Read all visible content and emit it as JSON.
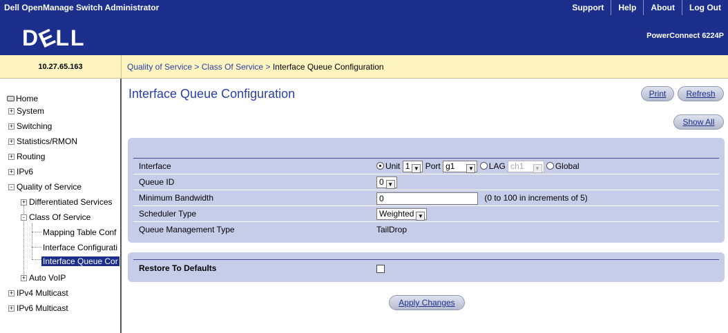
{
  "topbar": {
    "title": "Dell OpenManage Switch Administrator",
    "links": [
      "Support",
      "Help",
      "About",
      "Log Out"
    ]
  },
  "header": {
    "logo": "DELL",
    "model": "PowerConnect 6224P"
  },
  "ip_address": "10.27.65.163",
  "breadcrumb": {
    "items": [
      "Quality of Service",
      "Class Of Service"
    ],
    "separator": ">",
    "current": "Interface Queue Configuration"
  },
  "sidebar": {
    "items": [
      {
        "label": "Home"
      },
      {
        "label": "System",
        "exp": "+"
      },
      {
        "label": "Switching",
        "exp": "+"
      },
      {
        "label": "Statistics/RMON",
        "exp": "+"
      },
      {
        "label": "Routing",
        "exp": "+"
      },
      {
        "label": "IPv6",
        "exp": "+"
      },
      {
        "label": "Quality of Service",
        "exp": "-"
      },
      {
        "label": "Differentiated Services",
        "exp": "+"
      },
      {
        "label": "Class Of Service",
        "exp": "-"
      },
      {
        "label": "Mapping Table Conf"
      },
      {
        "label": "Interface Configurati"
      },
      {
        "label": "Interface Queue Cor"
      },
      {
        "label": "Auto VoIP",
        "exp": "+"
      },
      {
        "label": "IPv4 Multicast",
        "exp": "+"
      },
      {
        "label": "IPv6 Multicast",
        "exp": "+"
      }
    ]
  },
  "main": {
    "title": "Interface Queue Configuration",
    "buttons": {
      "print": "Print",
      "refresh": "Refresh",
      "show_all": "Show All",
      "apply": "Apply Changes"
    }
  },
  "form": {
    "interface": {
      "label": "Interface",
      "unit_label": "Unit",
      "unit_value": "1",
      "port_label": "Port",
      "port_value": "g1",
      "lag_label": "LAG",
      "lag_value": "ch1",
      "global_label": "Global",
      "selected": "Unit"
    },
    "queue_id": {
      "label": "Queue ID",
      "value": "0"
    },
    "min_bandwidth": {
      "label": "Minimum Bandwidth",
      "value": "0",
      "hint": "(0 to 100 in increments of 5)"
    },
    "scheduler_type": {
      "label": "Scheduler Type",
      "value": "Weighted"
    },
    "queue_mgmt": {
      "label": "Queue Management Type",
      "value": "TailDrop"
    }
  },
  "restore": {
    "label": "Restore To Defaults",
    "checked": false
  },
  "icons": {
    "expand": "plus-box-icon",
    "collapse": "minus-box-icon",
    "home": "home-icon",
    "dropdown": "chevron-down-icon"
  },
  "colors": {
    "brand_navy": "#1c2f8c",
    "panel": "#c6cde8",
    "crumb_bg": "#fdf4c0",
    "link": "#2a3fa6"
  }
}
